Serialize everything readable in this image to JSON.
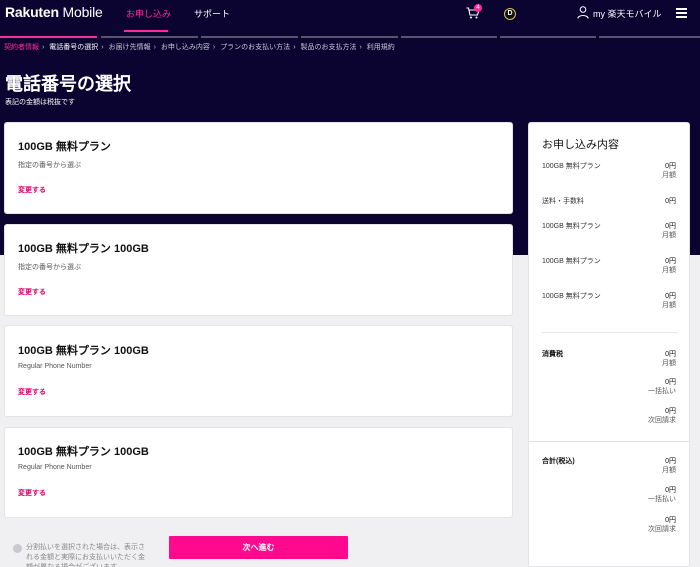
{
  "colors": {
    "hero": "#0b0330",
    "accent": "#ff2a9a",
    "button": "#ff0a8e",
    "background": "#f0f0f3"
  },
  "header": {
    "logo_brand": "Rakuten",
    "logo_product": " Mobile",
    "nav": [
      "お申し込み",
      "サポート"
    ],
    "cart_count": "4",
    "d_badge": "D",
    "user_label": "my 楽天モバイル",
    "icons": [
      "cart-icon",
      "d-point-icon",
      "user-icon",
      "menu-icon"
    ]
  },
  "breadcrumb": [
    {
      "label": "契約者情報",
      "state": "active"
    },
    {
      "label": "電話番号の選択",
      "state": "current"
    },
    {
      "label": "お届け先情報",
      "state": "todo"
    },
    {
      "label": "お申し込み内容",
      "state": "todo"
    },
    {
      "label": "プランのお支払い方法",
      "state": "todo"
    },
    {
      "label": "製品のお支払方法",
      "state": "todo"
    },
    {
      "label": "利用規約",
      "state": "todo"
    }
  ],
  "page": {
    "title": "電話番号の選択",
    "subtitle": "表記の金額は税抜です"
  },
  "plans": [
    {
      "title": "100GB 無料プラン",
      "sub": "指定の番号から選ぶ",
      "change": "変更する"
    },
    {
      "title": "100GB 無料プラン 100GB",
      "sub": "指定の番号から選ぶ",
      "change": "変更する"
    },
    {
      "title": "100GB 無料プラン 100GB",
      "sub": "Regular Phone Number",
      "change": "変更する"
    },
    {
      "title": "100GB 無料プラン 100GB",
      "sub": "Regular Phone Number",
      "change": "変更する"
    }
  ],
  "summary": {
    "title": "お申し込み内容",
    "items": [
      {
        "label": "100GB 無料プラン",
        "amount": "0円",
        "unit": "月額"
      },
      {
        "label": "送料・手数料",
        "amount": "0円",
        "unit": ""
      },
      {
        "label": "100GB 無料プラン",
        "amount": "0円",
        "unit": "月額"
      },
      {
        "label": "100GB 無料プラン",
        "amount": "0円",
        "unit": "月額"
      },
      {
        "label": "100GB 無料プラン",
        "amount": "0円",
        "unit": "月額"
      }
    ],
    "tax": {
      "label": "消費税",
      "rows": [
        {
          "amount": "0円",
          "unit": "月額"
        },
        {
          "amount": "0円",
          "unit": "一括払い"
        },
        {
          "amount": "0円",
          "unit": "次回請求"
        }
      ]
    },
    "total": {
      "label": "合計(税込)",
      "rows": [
        {
          "amount": "0円",
          "unit": "月額"
        },
        {
          "amount": "0円",
          "unit": "一括払い"
        },
        {
          "amount": "0円",
          "unit": "次回請求"
        }
      ]
    },
    "note": "分割払いを選択された場合は、表示される金額と実際にお支払いいただく金額が異なる場合がございます"
  },
  "next_button": "次へ進む"
}
